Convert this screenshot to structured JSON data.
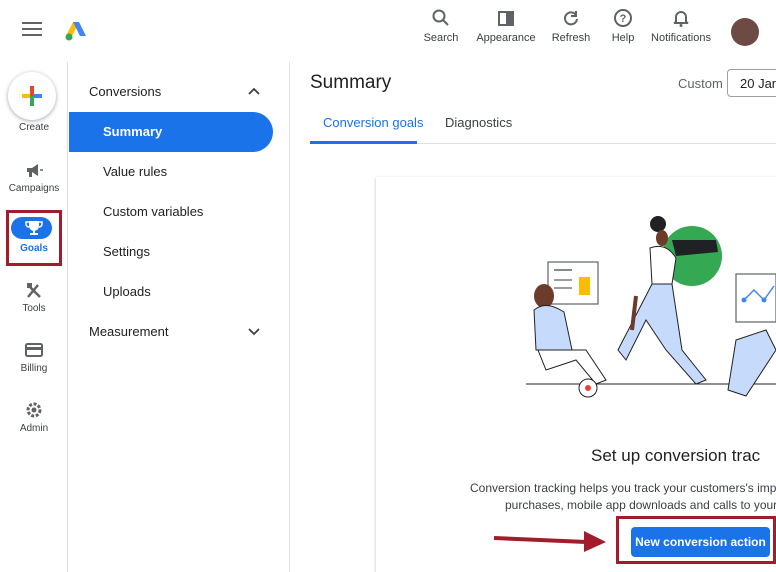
{
  "topbar": {
    "items": [
      {
        "label": "Search",
        "icon": "search-icon"
      },
      {
        "label": "Appearance",
        "icon": "appearance-icon"
      },
      {
        "label": "Refresh",
        "icon": "refresh-icon"
      },
      {
        "label": "Help",
        "icon": "help-icon"
      },
      {
        "label": "Notifications",
        "icon": "bell-icon"
      }
    ]
  },
  "rail": {
    "create": "Create",
    "items": [
      {
        "label": "Campaigns",
        "icon": "megaphone-icon"
      },
      {
        "label": "Goals",
        "icon": "trophy-icon"
      },
      {
        "label": "Tools",
        "icon": "tools-icon"
      },
      {
        "label": "Billing",
        "icon": "card-icon"
      },
      {
        "label": "Admin",
        "icon": "gear-icon"
      }
    ]
  },
  "subnav": {
    "section1": "Conversions",
    "items": [
      "Summary",
      "Value rules",
      "Custom variables",
      "Settings",
      "Uploads"
    ],
    "section2": "Measurement"
  },
  "main": {
    "title": "Summary",
    "custom_label": "Custom",
    "date": "20 Jan",
    "tabs": [
      "Conversion goals",
      "Diagnostics"
    ],
    "card": {
      "heading": "Set up conversion trac",
      "desc_line1": "Conversion tracking helps you track your customers's imp",
      "desc_line2": "purchases, mobile app downloads and calls to your",
      "button": "New conversion action"
    }
  },
  "colors": {
    "accent": "#1a73e8",
    "highlight": "#a11d2b"
  }
}
